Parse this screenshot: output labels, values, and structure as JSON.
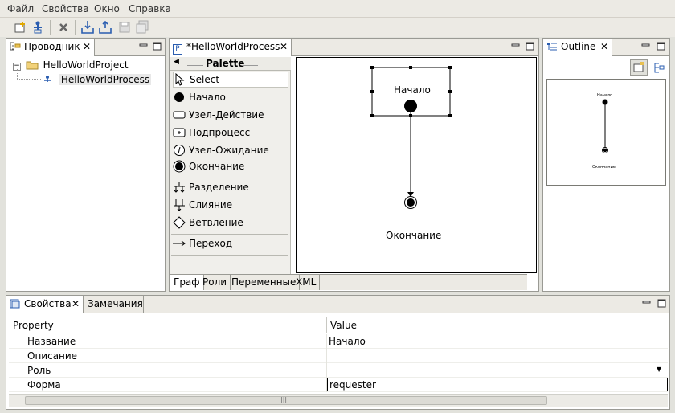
{
  "menu": [
    "Файл",
    "Свойства",
    "Окно",
    "Справка"
  ],
  "explorer": {
    "title": "Проводник",
    "tree": [
      {
        "label": "HelloWorldProject",
        "depth": 0
      },
      {
        "label": "HelloWorldProcess",
        "depth": 1
      }
    ]
  },
  "editor": {
    "title": "*HelloWorldProcess",
    "palette_title": "Palette",
    "palette": [
      {
        "label": "Select",
        "icon": "select-arrow-icon"
      },
      {
        "label": "Начало",
        "icon": "start-node-icon"
      },
      {
        "label": "Узел-Действие",
        "icon": "action-node-icon"
      },
      {
        "label": "Подпроцесс",
        "icon": "subprocess-icon"
      },
      {
        "label": "Узел-Ожидание",
        "icon": "wait-node-icon"
      },
      {
        "label": "Окончание",
        "icon": "end-node-icon"
      },
      {
        "label": "Разделение",
        "icon": "fork-icon"
      },
      {
        "label": "Слияние",
        "icon": "join-icon"
      },
      {
        "label": "Ветвление",
        "icon": "decision-icon"
      },
      {
        "label": "Переход",
        "icon": "transition-arrow-icon"
      }
    ],
    "diagram": {
      "start_label": "Начало",
      "end_label": "Окончание"
    },
    "tabs": [
      "Граф",
      "Роли",
      "Переменные",
      "XML"
    ],
    "active_tab": "Граф"
  },
  "outline": {
    "title": "Outline",
    "start_label": "Начало",
    "end_label": "Окончание"
  },
  "properties": {
    "tabs": [
      "Свойства",
      "Замечания"
    ],
    "col_property": "Property",
    "col_value": "Value",
    "rows": [
      {
        "name": "Название",
        "value": "Начало"
      },
      {
        "name": "Описание",
        "value": ""
      },
      {
        "name": "Роль",
        "value": ""
      },
      {
        "name": "Форма",
        "value": "requester"
      }
    ]
  }
}
